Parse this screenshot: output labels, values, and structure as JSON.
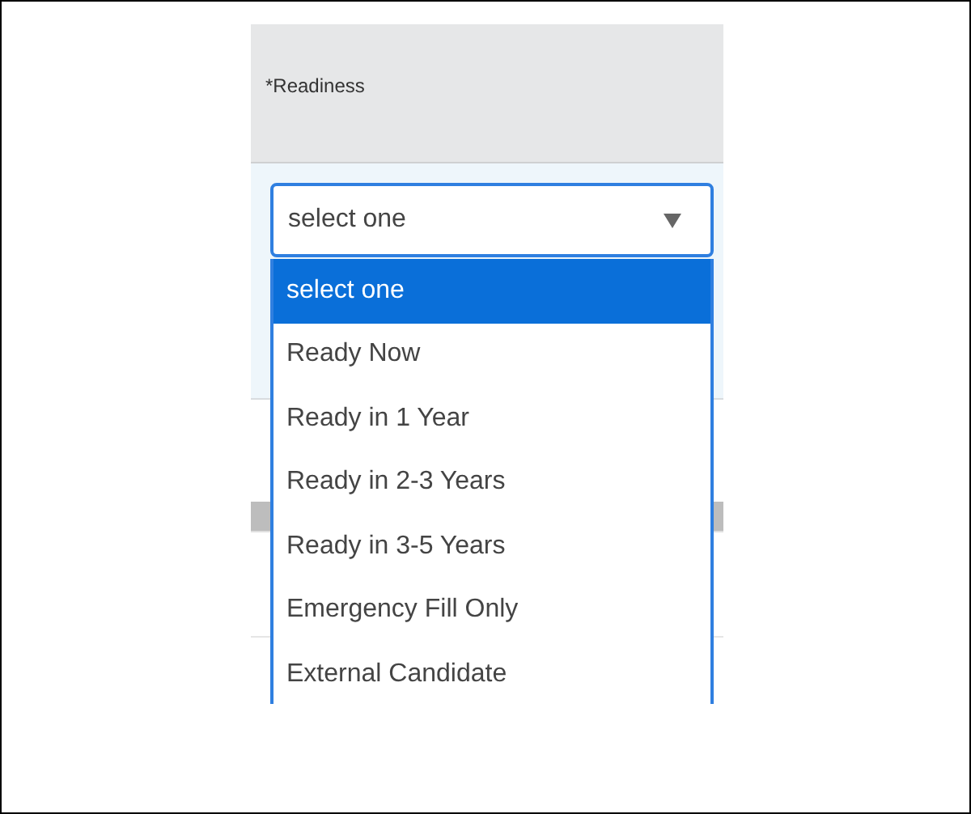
{
  "field": {
    "label": "*Readiness",
    "value": "select one",
    "expanded": true
  },
  "options": [
    {
      "label": "select one",
      "selected": true
    },
    {
      "label": "Ready Now",
      "selected": false
    },
    {
      "label": "Ready in 1 Year",
      "selected": false
    },
    {
      "label": "Ready in 2-3 Years",
      "selected": false
    },
    {
      "label": "Ready in 3-5 Years",
      "selected": false
    },
    {
      "label": "Emergency Fill Only",
      "selected": false
    },
    {
      "label": "External Candidate",
      "selected": false
    }
  ]
}
